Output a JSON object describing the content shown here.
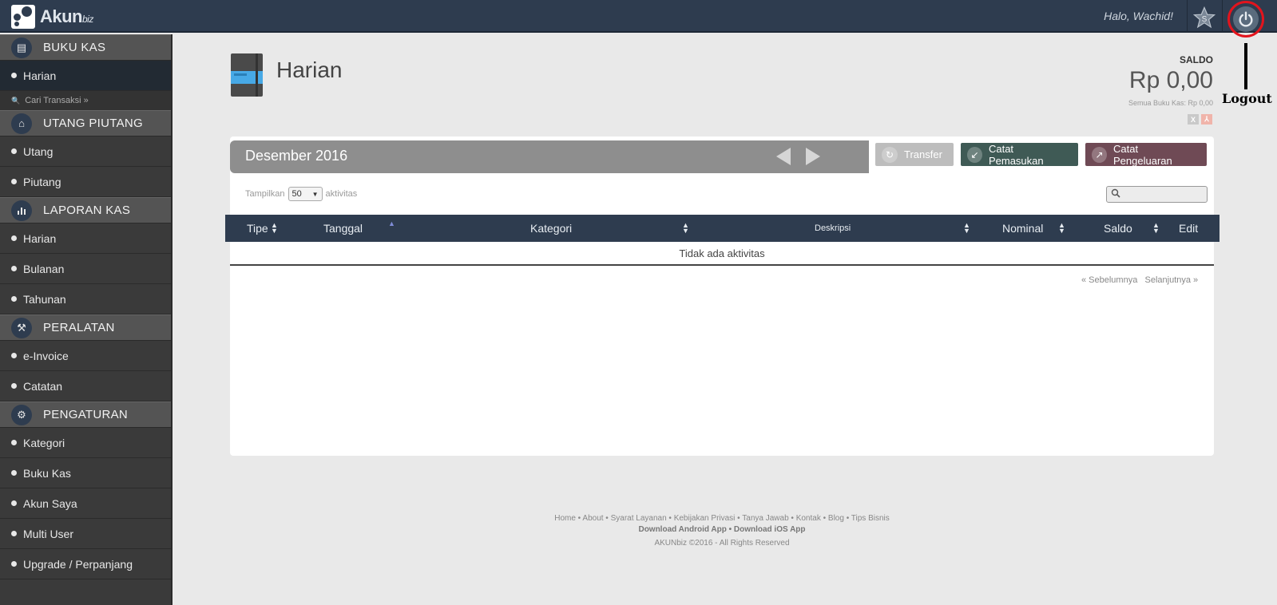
{
  "topbar": {
    "logo_text": "Akun",
    "logo_suffix": "biz",
    "greeting": "Halo, Wachid!",
    "star_icon": "star-icon",
    "power_icon": "power-icon",
    "power_ring_color": "#e2141d"
  },
  "annotation": {
    "label": "Logout"
  },
  "sidebar": {
    "search_label": "Cari Transaksi »",
    "sections": [
      {
        "label": "BUKU KAS",
        "icon": "book-icon",
        "items": [
          "Harian"
        ]
      },
      {
        "label": "UTANG PIUTANG",
        "icon": "bank-icon",
        "items": [
          "Utang",
          "Piutang"
        ]
      },
      {
        "label": "LAPORAN KAS",
        "icon": "bar-chart-icon",
        "items": [
          "Harian",
          "Bulanan",
          "Tahunan"
        ]
      },
      {
        "label": "PERALATAN",
        "icon": "wrench-icon",
        "items": [
          "e-Invoice",
          "Catatan"
        ]
      },
      {
        "label": "PENGATURAN",
        "icon": "gear-icon",
        "items": [
          "Kategori",
          "Buku Kas",
          "Akun Saya",
          "Multi User",
          "Upgrade / Perpanjang"
        ]
      }
    ]
  },
  "header": {
    "title": "Harian",
    "saldo_label": "SALDO",
    "saldo_value": "Rp 0,00",
    "saldo_sub": "Semua Buku Kas: Rp 0,00",
    "export_excel": "X",
    "export_pdf": "⅄"
  },
  "toolbar": {
    "month": "Desember 2016",
    "transfer": "Transfer",
    "catat_pemasukan": "Catat Pemasukan",
    "catat_pengeluaran": "Catat Pengeluaran"
  },
  "table": {
    "show_prefix": "Tampilkan",
    "show_value": "50",
    "show_suffix": "aktivitas",
    "columns": [
      "Tipe",
      "Tanggal",
      "Kategori",
      "Deskripsi",
      "Nominal",
      "Saldo",
      "Edit"
    ],
    "empty_text": "Tidak ada aktivitas",
    "pager_prev": "« Sebelumnya",
    "pager_next": "Selanjutnya »"
  },
  "footer": {
    "links": "Home • About • Syarat Layanan • Kebijakan Privasi • Tanya Jawab • Kontak • Blog • Tips Bisnis",
    "download": "Download Android App • Download iOS App",
    "copyright": "AKUNbiz ©2016 - All Rights Reserved"
  },
  "colors": {
    "topbar": "#2e3c4f",
    "sidebar": "#3a3a3a",
    "btn_masuk": "#3f5a55",
    "btn_keluar": "#6f4a55",
    "btn_transfer": "#bdbdbd"
  }
}
